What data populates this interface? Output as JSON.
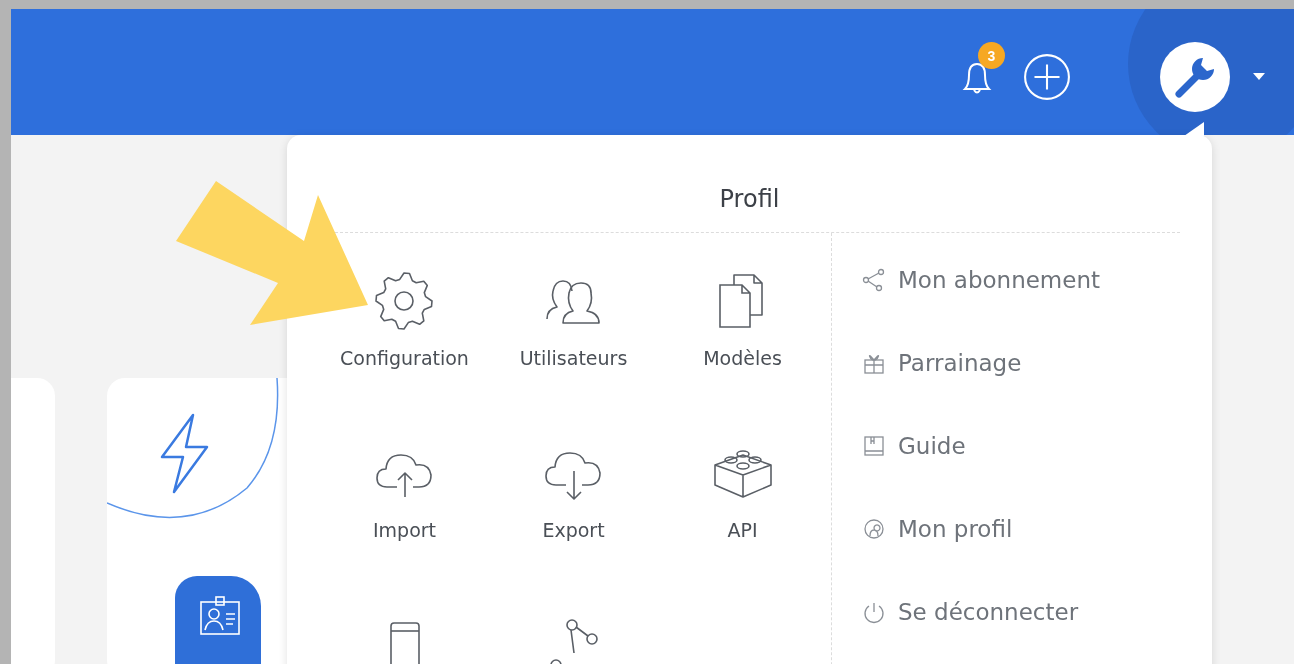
{
  "header": {
    "notification_count": "3"
  },
  "dropdown": {
    "title": "Profil",
    "grid_items": [
      {
        "label": "Configuration"
      },
      {
        "label": "Utilisateurs"
      },
      {
        "label": "Modèles"
      },
      {
        "label": "Import"
      },
      {
        "label": "Export"
      },
      {
        "label": "API"
      }
    ],
    "links": [
      {
        "label": "Mon abonnement"
      },
      {
        "label": "Parrainage"
      },
      {
        "label": "Guide"
      },
      {
        "label": "Mon profil"
      },
      {
        "label": "Se déconnecter"
      }
    ]
  }
}
